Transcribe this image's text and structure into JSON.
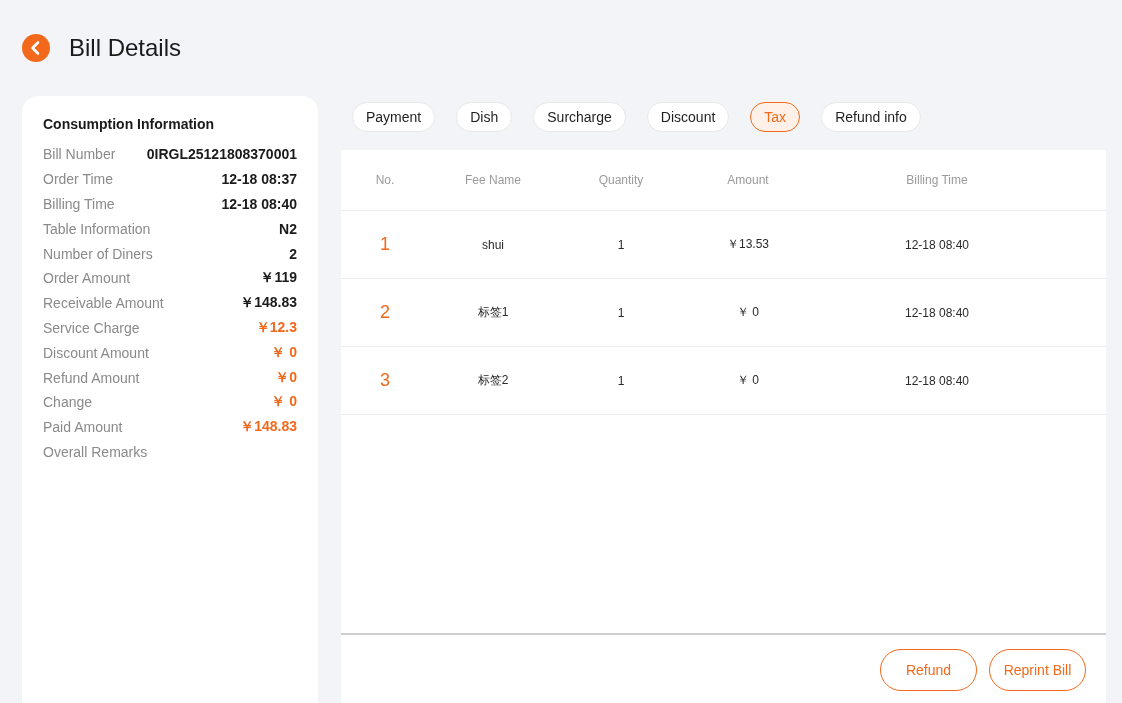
{
  "header": {
    "title": "Bill Details"
  },
  "consumption_info": {
    "title": "Consumption Information",
    "rows": [
      {
        "label": "Bill Number",
        "value": "0IRGL25121808370001",
        "highlight": false
      },
      {
        "label": "Order Time",
        "value": "12-18 08:37",
        "highlight": false
      },
      {
        "label": "Billing Time",
        "value": "12-18 08:40",
        "highlight": false
      },
      {
        "label": "Table Information",
        "value": "N2",
        "highlight": false
      },
      {
        "label": "Number of Diners",
        "value": "2",
        "highlight": false
      },
      {
        "label": "Order Amount",
        "value": "￥119",
        "highlight": false
      },
      {
        "label": "Receivable Amount",
        "value": "￥148.83",
        "highlight": false
      },
      {
        "label": "Service Charge",
        "value": "￥12.3",
        "highlight": true
      },
      {
        "label": "Discount Amount",
        "value": "￥ 0",
        "highlight": true
      },
      {
        "label": "Refund Amount",
        "value": "￥0",
        "highlight": true
      },
      {
        "label": "Change",
        "value": "￥ 0",
        "highlight": true
      },
      {
        "label": "Paid Amount",
        "value": "￥148.83",
        "highlight": true
      },
      {
        "label": "Overall Remarks"
      }
    ]
  },
  "tabs": [
    {
      "label": "Payment",
      "selected": false
    },
    {
      "label": "Dish",
      "selected": false
    },
    {
      "label": "Surcharge",
      "selected": false
    },
    {
      "label": "Discount",
      "selected": false
    },
    {
      "label": "Tax",
      "selected": true
    },
    {
      "label": "Refund info",
      "selected": false
    }
  ],
  "table": {
    "columns": [
      "No.",
      "Fee Name",
      "Quantity",
      "Amount",
      "Billing Time"
    ],
    "rows": [
      [
        "1",
        "shui",
        "1",
        "￥13.53",
        "12-18 08:40"
      ],
      [
        "2",
        "标签1",
        "1",
        "￥ 0",
        "12-18 08:40"
      ],
      [
        "3",
        "标签2",
        "1",
        "￥ 0",
        "12-18 08:40"
      ]
    ]
  },
  "buttons": [
    "Refund",
    "Reprint Bill"
  ]
}
